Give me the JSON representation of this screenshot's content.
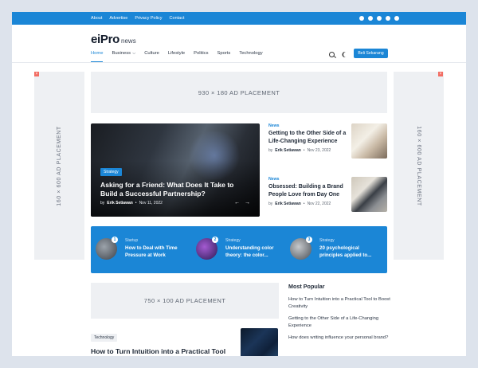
{
  "topbar": {
    "links": [
      "About",
      "Advertise",
      "Privacy Policy",
      "Contact"
    ],
    "socials": [
      "facebook-icon",
      "tiktok-icon",
      "linkedin-icon",
      "twitter-icon",
      "youtube-icon"
    ]
  },
  "brand": {
    "name": "eiPro",
    "suffix": "news"
  },
  "nav": {
    "items": [
      {
        "label": "Home",
        "active": true
      },
      {
        "label": "Business",
        "dropdown": true
      },
      {
        "label": "Culture"
      },
      {
        "label": "Lifestyle"
      },
      {
        "label": "Politics"
      },
      {
        "label": "Sports"
      },
      {
        "label": "Technology"
      }
    ],
    "buy_label": "Beli Sekarang"
  },
  "ads": {
    "top": "930 × 180   AD PLACEMENT",
    "side": "160 × 600   AD PLACEMENT",
    "mid": "750 × 100   AD PLACEMENT",
    "close": "×"
  },
  "hero": {
    "category": "Strategy",
    "title": "Asking for a Friend: What Does It Take to Build a Successful Partnership?",
    "author": "Erik Setiawan",
    "date": "Nov 11, 2022",
    "prev": "←",
    "next": "→"
  },
  "side_articles": [
    {
      "category": "News",
      "title": "Getting to the Other Side of a Life-Changing Experience",
      "author": "Erik Setiawan",
      "date": "Nov 23, 2022"
    },
    {
      "category": "News",
      "title": "Obsessed: Building a Brand People Love from Day One",
      "author": "Erik Setiawan",
      "date": "Nov 22, 2022"
    }
  ],
  "strip": [
    {
      "num": "1",
      "category": "Startup",
      "title": "How to Deal with Time Pressure at Work"
    },
    {
      "num": "2",
      "category": "Strategy",
      "title": "Understanding color theory: the color..."
    },
    {
      "num": "3",
      "category": "Strategy",
      "title": "20 psychological principles applied to..."
    }
  ],
  "popular": {
    "heading": "Most Popular",
    "items": [
      "How to Turn Intuition into a Practical Tool to Boost Creativity",
      "Getting to the Other Side of a Life-Changing Experience",
      "How does writing influence your personal brand?"
    ]
  },
  "bottom": {
    "category": "Technology",
    "title": "How to Turn Intuition into a Practical Tool to Boost Creativity"
  },
  "colors": {
    "accent": "#1b86d6"
  }
}
